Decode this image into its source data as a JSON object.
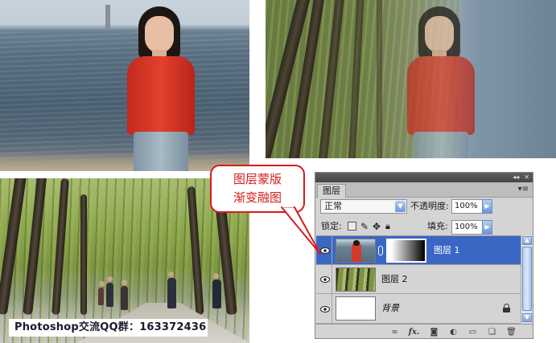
{
  "callout": {
    "line1": "图层蒙版",
    "line2": "渐变融图"
  },
  "watermark": "Photoshop交流QQ群：163372436",
  "colors": {
    "selection": "#3a67c4",
    "callout_red": "#d61b1b",
    "panel_bg": "#d4d4d4"
  },
  "layers_panel": {
    "tab_label": "图层",
    "blend_mode": "正常",
    "opacity_label": "不透明度:",
    "opacity_value": "100%",
    "lock_label": "锁定:",
    "fill_label": "填充:",
    "fill_value": "100%",
    "layers": [
      {
        "name": "图层 1",
        "visible": true,
        "selected": true,
        "has_mask": true
      },
      {
        "name": "图层 2",
        "visible": true,
        "selected": false,
        "has_mask": false
      },
      {
        "name": "背景",
        "visible": true,
        "selected": false,
        "locked": true
      }
    ],
    "footer_icons": [
      "link-icon",
      "fx-icon",
      "mask-icon",
      "adjustment-icon",
      "group-icon",
      "new-layer-icon",
      "trash-icon"
    ]
  }
}
